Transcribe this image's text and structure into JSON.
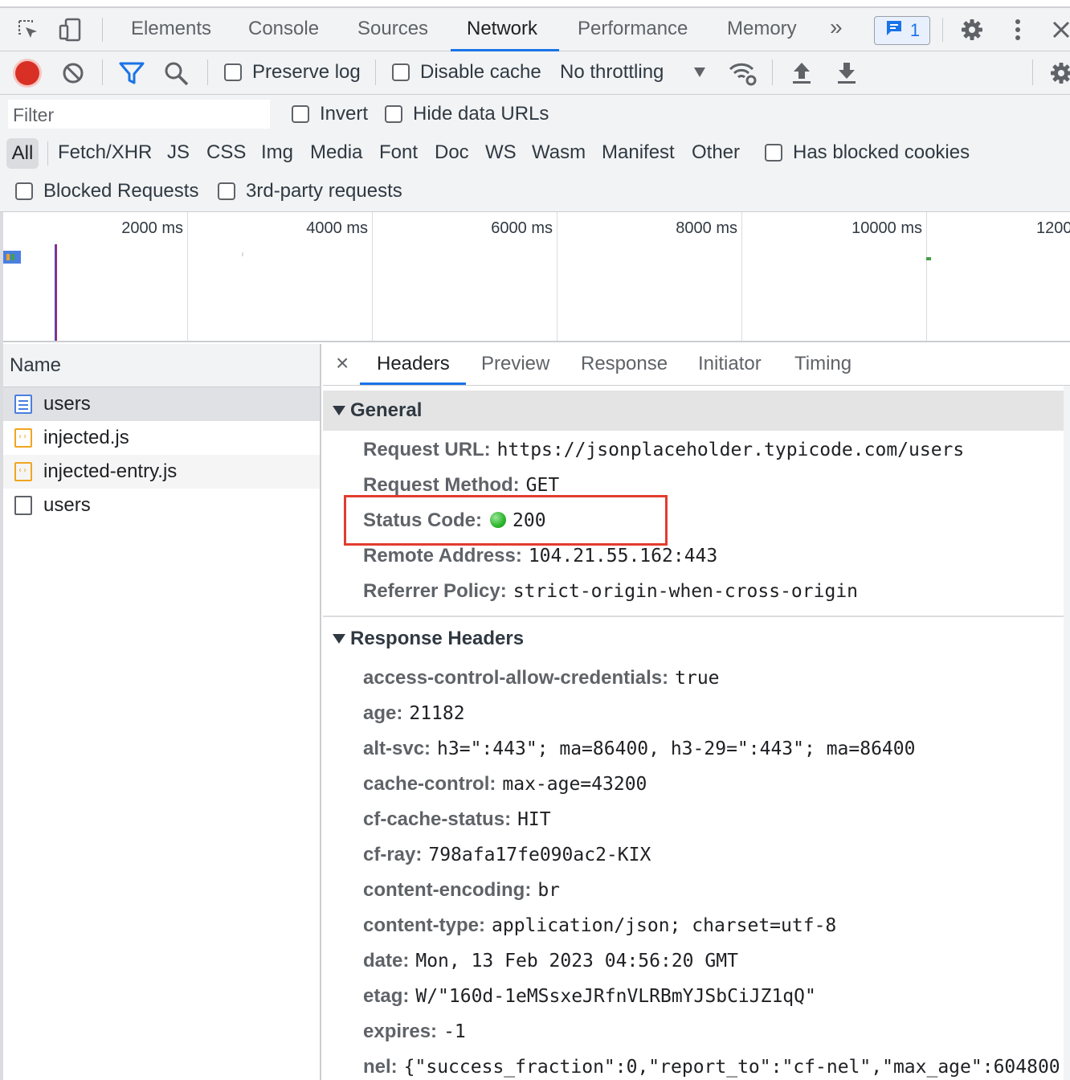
{
  "tabbar": {
    "tabs": [
      "Elements",
      "Console",
      "Sources",
      "Network",
      "Performance",
      "Memory"
    ],
    "active": "Network",
    "more_label": "»",
    "issues_count": "1"
  },
  "toolbar": {
    "preserve_log": "Preserve log",
    "disable_cache": "Disable cache",
    "throttling": "No throttling"
  },
  "filter": {
    "placeholder": "Filter",
    "invert": "Invert",
    "hide_data_urls": "Hide data URLs",
    "types": [
      "All",
      "Fetch/XHR",
      "JS",
      "CSS",
      "Img",
      "Media",
      "Font",
      "Doc",
      "WS",
      "Wasm",
      "Manifest",
      "Other"
    ],
    "active_type": "All",
    "has_blocked_cookies": "Has blocked cookies",
    "blocked_requests": "Blocked Requests",
    "third_party": "3rd-party requests"
  },
  "timeline": {
    "labels": [
      "2000 ms",
      "4000 ms",
      "6000 ms",
      "8000 ms",
      "10000 ms",
      "1200"
    ]
  },
  "requests": {
    "header": "Name",
    "items": [
      {
        "name": "users",
        "type": "document",
        "selected": true
      },
      {
        "name": "injected.js",
        "type": "script"
      },
      {
        "name": "injected-entry.js",
        "type": "script"
      },
      {
        "name": "users",
        "type": "other"
      }
    ]
  },
  "detail": {
    "close": "×",
    "tabs": [
      "Headers",
      "Preview",
      "Response",
      "Initiator",
      "Timing"
    ],
    "active_tab": "Headers",
    "general": {
      "title": "General",
      "rows": [
        {
          "key": "Request URL:",
          "value": "https://jsonplaceholder.typicode.com/users"
        },
        {
          "key": "Request Method:",
          "value": "GET"
        },
        {
          "key": "Status Code:",
          "value": "200"
        },
        {
          "key": "Remote Address:",
          "value": "104.21.55.162:443"
        },
        {
          "key": "Referrer Policy:",
          "value": "strict-origin-when-cross-origin"
        }
      ]
    },
    "response_headers": {
      "title": "Response Headers",
      "rows": [
        {
          "key": "access-control-allow-credentials:",
          "value": "true"
        },
        {
          "key": "age:",
          "value": "21182"
        },
        {
          "key": "alt-svc:",
          "value": "h3=\":443\"; ma=86400, h3-29=\":443\"; ma=86400"
        },
        {
          "key": "cache-control:",
          "value": "max-age=43200"
        },
        {
          "key": "cf-cache-status:",
          "value": "HIT"
        },
        {
          "key": "cf-ray:",
          "value": "798afa17fe090ac2-KIX"
        },
        {
          "key": "content-encoding:",
          "value": "br"
        },
        {
          "key": "content-type:",
          "value": "application/json; charset=utf-8"
        },
        {
          "key": "date:",
          "value": "Mon, 13 Feb 2023 04:56:20 GMT"
        },
        {
          "key": "etag:",
          "value": "W/\"160d-1eMSsxeJRfnVLRBmYJSbCiJZ1qQ\""
        },
        {
          "key": "expires:",
          "value": "-1"
        },
        {
          "key": "nel:",
          "value": "{\"success_fraction\":0,\"report_to\":\"cf-nel\",\"max_age\":604800}"
        }
      ]
    }
  },
  "colors": {
    "accent": "#1a73e8",
    "record": "#d93025",
    "status_ok": "#2ab52a",
    "highlight": "#e23c2f"
  }
}
